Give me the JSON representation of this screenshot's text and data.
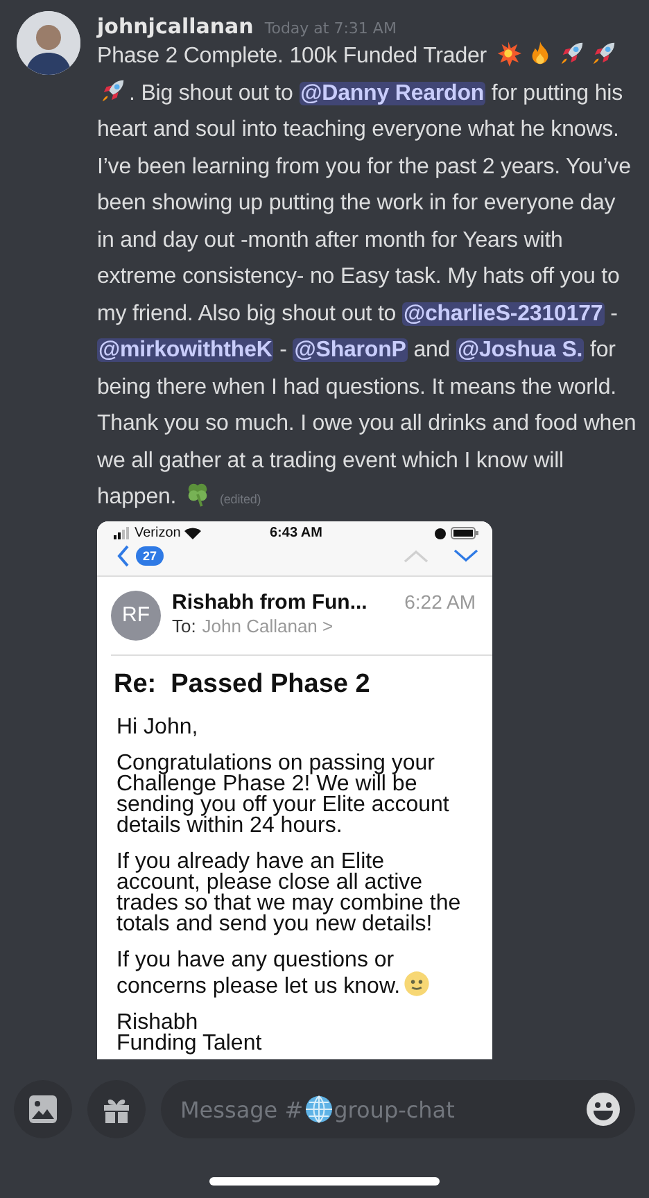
{
  "message": {
    "author": "johnjcallanan",
    "timestamp": "Today at 7:31 AM",
    "segments": [
      {
        "kind": "text",
        "text": "Phase 2 Complete. 100k Funded Trader "
      },
      {
        "kind": "boom"
      },
      {
        "kind": "fire"
      },
      {
        "kind": "rocket"
      },
      {
        "kind": "rocket"
      },
      {
        "kind": "rocket"
      },
      {
        "kind": "text",
        "text": ". Big shout out to "
      },
      {
        "kind": "mention",
        "text": "@Danny Reardon"
      },
      {
        "kind": "text",
        "text": " for putting his heart and soul into teaching everyone what he knows. I’ve been learning from you for the past 2 years. You’ve been showing up putting the work in for everyone day in and day out -month after month for Years with extreme consistency- no Easy task. My hats off you to my friend. Also big shout out to "
      },
      {
        "kind": "mention",
        "text": "@charlieS-2310177"
      },
      {
        "kind": "text",
        "text": " - "
      },
      {
        "kind": "mention",
        "text": "@mirkowiththeK"
      },
      {
        "kind": "text",
        "text": " - "
      },
      {
        "kind": "mention",
        "text": "@SharonP"
      },
      {
        "kind": "text",
        "text": " and "
      },
      {
        "kind": "mention",
        "text": "@Joshua S."
      },
      {
        "kind": "text",
        "text": " for being there when I had questions. It means the world. Thank you so much. I owe you all drinks and food when we all gather at a trading event which I know will happen. "
      },
      {
        "kind": "clover"
      },
      {
        "kind": "edited",
        "text": "(edited)"
      }
    ],
    "attachment": {
      "status_bar": {
        "carrier": "Verizon",
        "time": "6:43 AM"
      },
      "nav": {
        "unread": "27",
        "prev_disabled": true,
        "next_disabled": false
      },
      "sender": {
        "initials": "RF",
        "name": "Rishabh from Fun...",
        "time": "6:22 AM",
        "to_label": "To:",
        "to": "John Callanan >"
      },
      "subject": "Re:  Passed Phase 2",
      "body": [
        "Hi John,",
        "Congratulations on passing your Challenge Phase 2! We will be sending you off your Elite account details within 24 hours.",
        "If you already have an Elite account, please close all active trades so that we may combine the totals and send you new details!",
        "If you have any questions or concerns please let us know."
      ],
      "signature": [
        "Rishabh",
        "Funding Talent"
      ]
    }
  },
  "composer": {
    "prefix": "Message #",
    "channel": "group-chat"
  }
}
